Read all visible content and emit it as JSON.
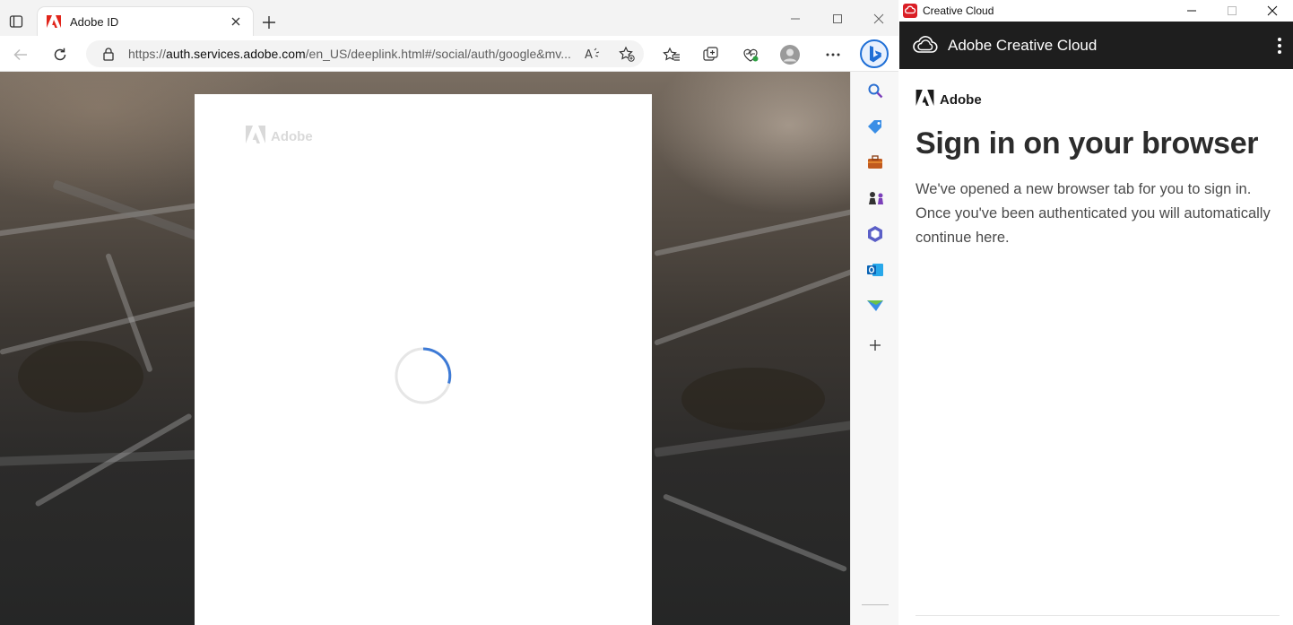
{
  "browser": {
    "tab": {
      "title": "Adobe ID"
    },
    "address": {
      "url_prefix": "https://",
      "url_host": "auth.services.adobe.com",
      "url_path": "/en_US/deeplink.html#/social/auth/google&mv..."
    },
    "page": {
      "card_logo_text": "Adobe"
    }
  },
  "cc": {
    "window_title": "Creative Cloud",
    "header_title": "Adobe Creative Cloud",
    "adobe_mark": "Adobe",
    "heading": "Sign in on your browser",
    "body": "We've opened a new browser tab for you to sign in. Once you've been authenticated you will automatically continue here."
  },
  "colors": {
    "adobe_red": "#e1251b",
    "cc_header_bg": "#1e1e1e",
    "spinner_blue": "#3d7ad6",
    "bing_blue": "#1f6fd6"
  },
  "icons": {
    "sidebar": [
      "search-icon",
      "tag-icon",
      "briefcase-icon",
      "chess-icon",
      "office-icon",
      "outlook-icon",
      "send-icon",
      "plus-icon"
    ]
  }
}
